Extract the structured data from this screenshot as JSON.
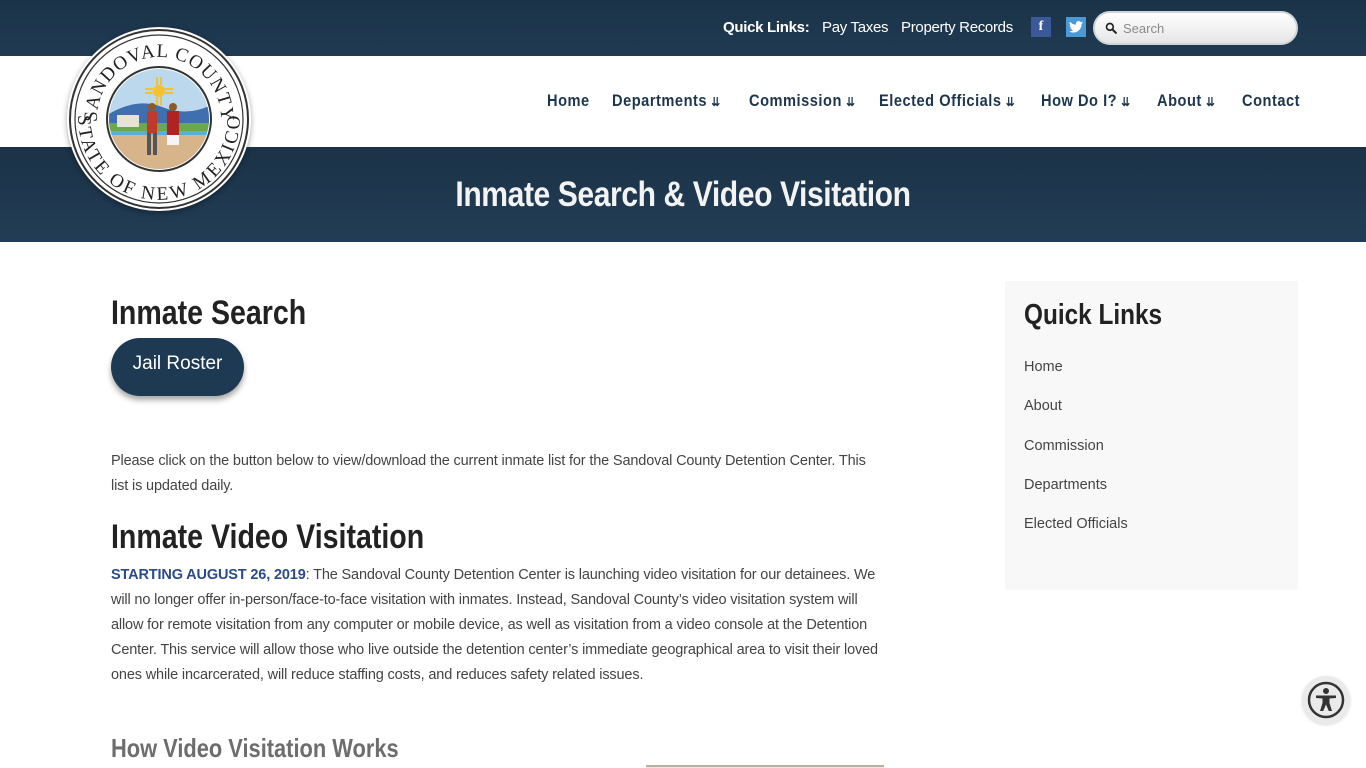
{
  "topbar": {
    "quick_links_label": "Quick Links:",
    "links": [
      "Pay Taxes",
      "Property Records"
    ],
    "social": [
      {
        "name": "facebook",
        "glyph": "f",
        "color": "#3b5998"
      },
      {
        "name": "twitter",
        "glyph": "twitter-bird",
        "color": "#4a9ad6"
      }
    ],
    "search_placeholder": "Search"
  },
  "logo": {
    "top_text": "SANDOVAL COUNTY",
    "bottom_text": "STATE OF NEW MEXICO",
    "alt": "Sandoval County Seal"
  },
  "nav": {
    "items": [
      {
        "label": "Home",
        "dropdown": false
      },
      {
        "label": "Departments",
        "dropdown": true
      },
      {
        "label": "Commission",
        "dropdown": true
      },
      {
        "label": "Elected Officials",
        "dropdown": true
      },
      {
        "label": "How Do I?",
        "dropdown": true
      },
      {
        "label": "About",
        "dropdown": true
      },
      {
        "label": "Contact",
        "dropdown": false
      }
    ],
    "chevron": "»"
  },
  "banner": {
    "title": "Inmate Search & Video Visitation"
  },
  "content": {
    "inmate_search_heading": "Inmate Search",
    "jail_roster_button": "Jail Roster",
    "inmate_search_text": "Please click on the button below to view/download the current inmate list for the Sandoval County Detention Center. This list is updated daily.",
    "video_heading": "Inmate Video Visitation",
    "video_lead": "STARTING AUGUST 26, 2019",
    "video_text": ": The Sandoval County Detention Center is launching video visitation for our detainees. We will no longer offer in-person/face-to-face visitation with inmates. Instead, Sandoval County’s video visitation system will allow for remote visitation from any computer or mobile device, as well as visitation from a video console at the Detention Center. This service will allow those who live outside the detention center’s immediate geographical area to visit their loved ones while incarcerated, will reduce staffing costs, and reduces safety related issues.",
    "how_heading": "How Video Visitation Works"
  },
  "sidebar": {
    "title": "Quick Links",
    "links": [
      "Home",
      "About",
      "Commission",
      "Departments",
      "Elected Officials"
    ]
  },
  "colors": {
    "navy": "#1d364d",
    "accent_blue": "#2a4a8a",
    "sidebar_bg": "#f8f8f8"
  }
}
